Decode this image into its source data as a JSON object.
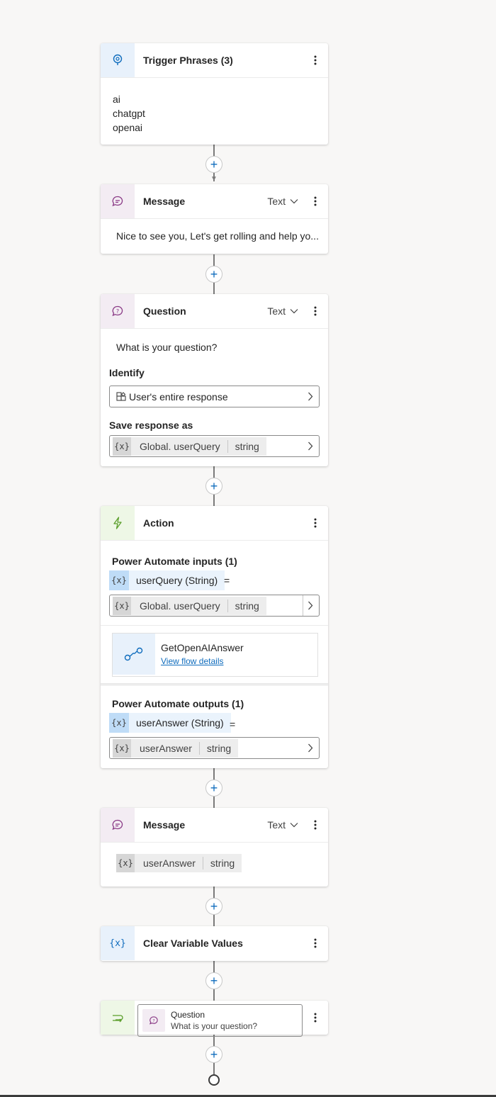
{
  "trigger": {
    "title": "Trigger Phrases (3)",
    "phrases": [
      "ai",
      "chatgpt",
      "openai"
    ]
  },
  "message1": {
    "title": "Message",
    "type": "Text",
    "text": "Nice to see you, Let's get rolling and help yo..."
  },
  "question": {
    "title": "Question",
    "type": "Text",
    "text": "What is your question?",
    "identify_label": "Identify",
    "identify_value": "User's entire response",
    "save_label": "Save response as",
    "save_var_icon": "{x}",
    "save_var_name": "Global. userQuery",
    "save_var_type": "string"
  },
  "action": {
    "title": "Action",
    "inputs_label": "Power Automate inputs (1)",
    "input_param": "userQuery (String)",
    "input_equals": "=",
    "input_var_icon": "{x}",
    "input_var_name": "Global. userQuery",
    "input_var_type": "string",
    "flow_name": "GetOpenAIAnswer",
    "flow_link": "View flow details",
    "outputs_label": "Power Automate outputs (1)",
    "output_param": "userAnswer (String)",
    "output_equals": "=",
    "output_var_icon": "{x}",
    "output_var_name": "userAnswer",
    "output_var_type": "string"
  },
  "message2": {
    "title": "Message",
    "type": "Text",
    "var_icon": "{x}",
    "var_name": "userAnswer",
    "var_type": "string"
  },
  "clear": {
    "title": "Clear Variable Values",
    "icon_text": "{x}"
  },
  "redirect": {
    "title": "Question",
    "subtitle": "What is your question?"
  },
  "colors": {
    "accent": "#0f6cbd",
    "canvas": "#f8f7f6",
    "purple_icon": "#8a3a86",
    "green_icon": "#5a9e2a"
  },
  "icons": [
    "trigger-bulb-icon",
    "chat-bubble-icon",
    "question-bubble-icon",
    "lightning-icon",
    "flow-icon",
    "variable-icon",
    "redirect-icon",
    "chevron-down-icon",
    "chevron-right-icon",
    "more-vertical-icon",
    "plus-icon"
  ]
}
